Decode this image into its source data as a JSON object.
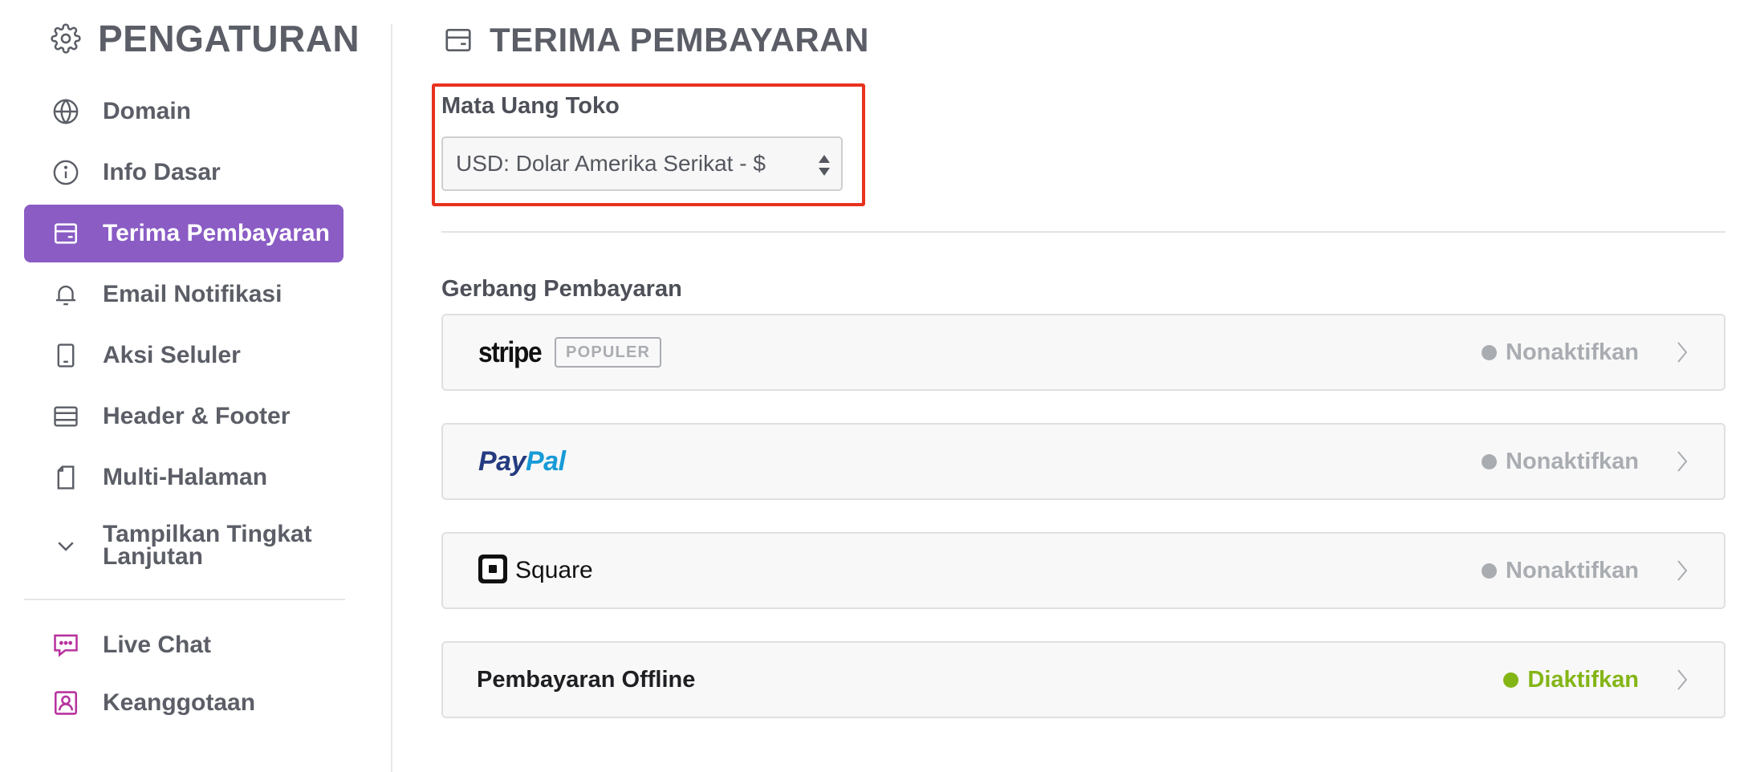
{
  "sidebar": {
    "title": "PENGATURAN",
    "items": [
      {
        "label": "Domain",
        "icon": "globe-icon"
      },
      {
        "label": "Info Dasar",
        "icon": "info-icon"
      },
      {
        "label": "Terima Pembayaran",
        "icon": "payment-card-icon",
        "active": true
      },
      {
        "label": "Email Notifikasi",
        "icon": "bell-icon"
      },
      {
        "label": "Aksi Seluler",
        "icon": "mobile-icon"
      },
      {
        "label": "Header & Footer",
        "icon": "header-footer-icon"
      },
      {
        "label": "Multi-Halaman",
        "icon": "pages-icon"
      },
      {
        "label_line1": "Tampilkan Tingkat",
        "label_line2": "Lanjutan",
        "icon": "chevron-down-icon"
      }
    ],
    "extras": [
      {
        "label": "Live Chat",
        "icon": "chat-icon"
      },
      {
        "label": "Keanggotaan",
        "icon": "membership-icon"
      }
    ]
  },
  "main": {
    "title": "TERIMA PEMBAYARAN",
    "currency": {
      "label": "Mata Uang Toko",
      "value": "USD: Dolar Amerika Serikat - $"
    },
    "gateways_label": "Gerbang Pembayaran",
    "gateways": [
      {
        "name": "stripe",
        "badge": "POPULER",
        "status": "Nonaktifkan"
      },
      {
        "name_part1": "Pay",
        "name_part2": "Pal",
        "status": "Nonaktifkan"
      },
      {
        "name": "Square",
        "status": "Nonaktifkan"
      },
      {
        "name": "Pembayaran Offline",
        "status": "Diaktifkan"
      }
    ]
  },
  "colors": {
    "accent": "#8a5cc4",
    "highlight": "#e8321e",
    "disabled": "#a9acb1",
    "enabled": "#84b516",
    "extras_icon": "#b8339e",
    "paypal_dark": "#253b80",
    "paypal_light": "#179bd7"
  }
}
